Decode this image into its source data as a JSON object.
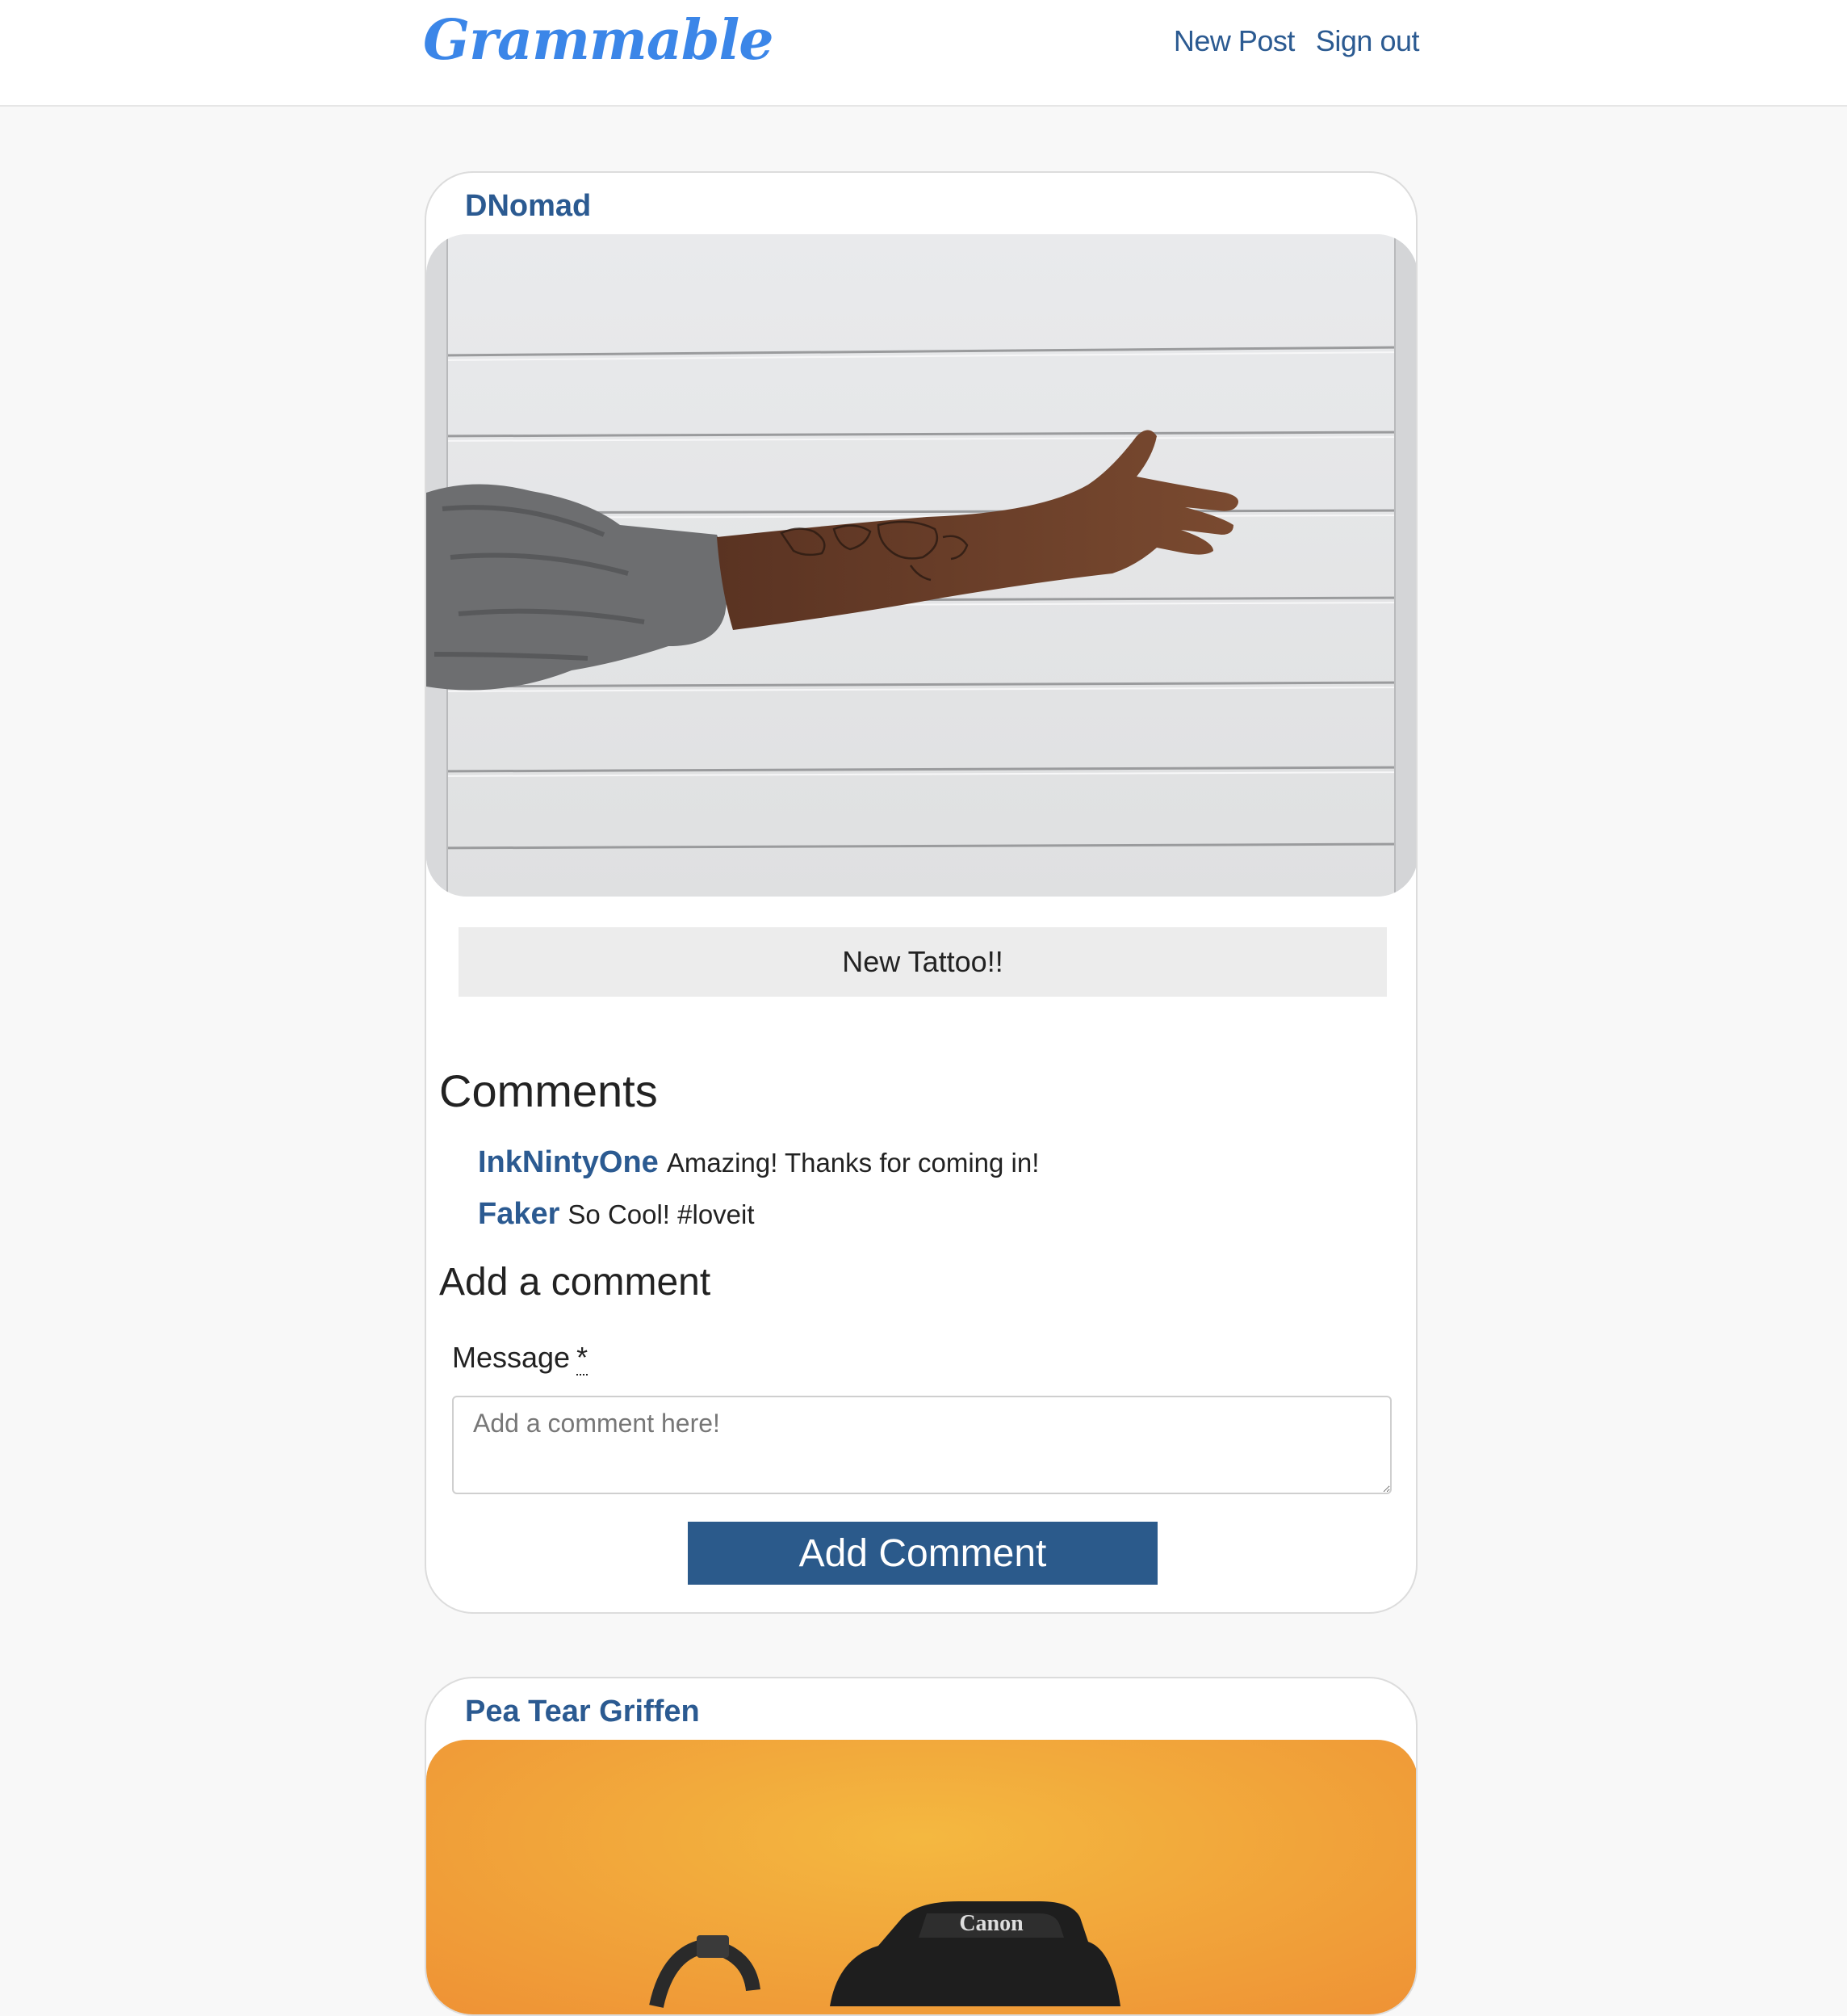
{
  "navbar": {
    "brand": "Grammable",
    "new_post_label": "New Post",
    "sign_out_label": "Sign out",
    "brand_color": "#3b86e8",
    "link_color": "#2b5a91"
  },
  "posts": [
    {
      "author": "DNomad",
      "caption": "New Tattoo!!",
      "comments_heading": "Comments",
      "comments": [
        {
          "author": "InkNintyOne",
          "message": "Amazing! Thanks for coming in!"
        },
        {
          "author": "Faker",
          "message": "So Cool! #loveit"
        }
      ],
      "form": {
        "heading": "Add a comment",
        "message_label": "Message",
        "required_marker": "*",
        "placeholder": "Add a comment here!",
        "submit_label": "Add Comment"
      }
    },
    {
      "author": "Pea Tear Griffen",
      "image_text": "Canon"
    }
  ],
  "colors": {
    "page_bg": "#f8f8f8",
    "accent": "#2b5a91",
    "button_bg": "#2b5a8b",
    "caption_bg": "#ececec"
  }
}
